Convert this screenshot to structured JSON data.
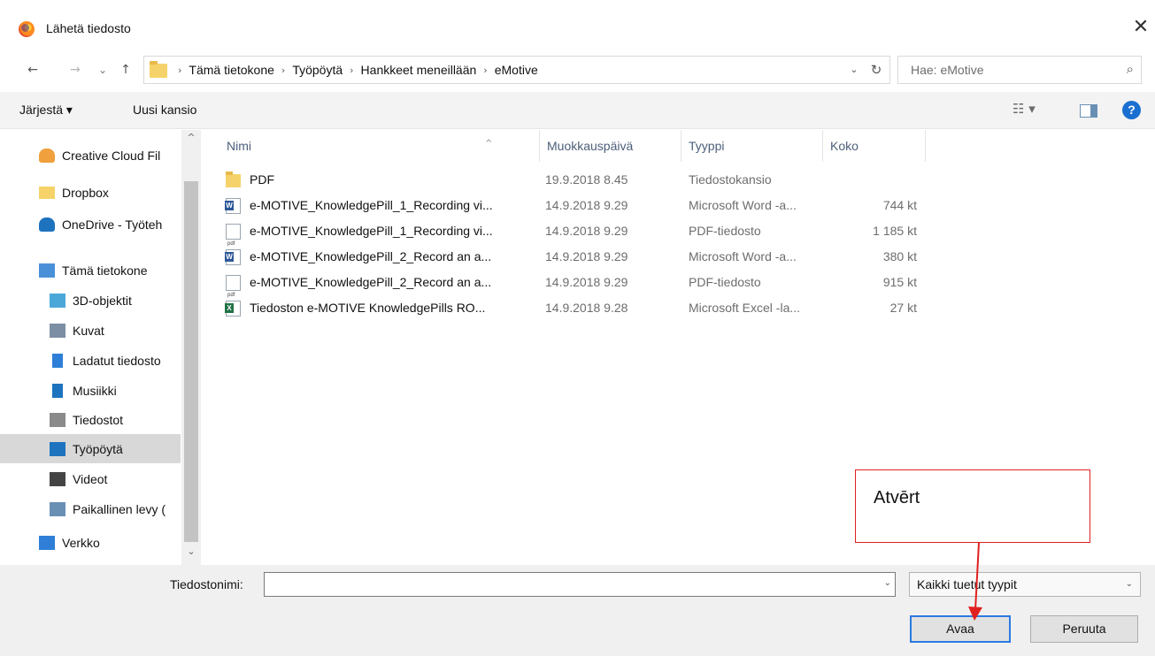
{
  "window": {
    "title": "Lähetä tiedosto",
    "close_glyph": "✕"
  },
  "nav": {
    "back_glyph": "←",
    "forward_glyph": "→",
    "recent_glyph": "⌄",
    "up_glyph": "↑"
  },
  "address": {
    "crumbs": [
      "Tämä tietokone",
      "Työpöytä",
      "Hankkeet meneillään",
      "eMotive"
    ],
    "sep_glyph": "›",
    "dropdown_glyph": "⌄",
    "refresh_glyph": "↻"
  },
  "search": {
    "placeholder": "Hae: eMotive",
    "icon_glyph": "⌕"
  },
  "toolbar": {
    "organize_label": "Järjestä ▾",
    "new_folder_label": "Uusi kansio",
    "view_glyph": "☷ ▾",
    "help_glyph": "?"
  },
  "sidebar": {
    "items": [
      {
        "label": "Creative Cloud Fil",
        "icon": "creative-cloud-icon",
        "color": "#f0a03c"
      },
      {
        "label": "Dropbox",
        "icon": "folder-icon",
        "color": "#f6d36a"
      },
      {
        "label": "OneDrive - Työteh",
        "icon": "onedrive-icon",
        "color": "#1e73be"
      },
      {
        "label": "Tämä tietokone",
        "icon": "computer-icon",
        "color": "#4a90d9"
      },
      {
        "label": "3D-objektit",
        "icon": "cube-icon",
        "color": "#4ca7d9"
      },
      {
        "label": "Kuvat",
        "icon": "pictures-icon",
        "color": "#7c8ea3"
      },
      {
        "label": "Ladatut tiedosto",
        "icon": "download-icon",
        "color": "#2f7fd8"
      },
      {
        "label": "Musiikki",
        "icon": "music-icon",
        "color": "#1e73be"
      },
      {
        "label": "Tiedostot",
        "icon": "documents-icon",
        "color": "#8a8a8a"
      },
      {
        "label": "Työpöytä",
        "icon": "desktop-icon",
        "color": "#1e73be",
        "selected": true
      },
      {
        "label": "Videot",
        "icon": "video-icon",
        "color": "#444444"
      },
      {
        "label": "Paikallinen levy (",
        "icon": "drive-icon",
        "color": "#6a8fb5"
      },
      {
        "label": "Verkko",
        "icon": "network-icon",
        "color": "#2f7fd8"
      }
    ],
    "scroll_up_glyph": "^",
    "scroll_down_glyph": "⌄"
  },
  "columns": {
    "name": "Nimi",
    "date": "Muokkauspäivä",
    "type": "Tyyppi",
    "size": "Koko",
    "sort_glyph": "^"
  },
  "files": [
    {
      "name": "PDF",
      "date": "19.9.2018 8.45",
      "type": "Tiedostokansio",
      "size": "",
      "icon": "folder"
    },
    {
      "name": "e-MOTIVE_KnowledgePill_1_Recording vi...",
      "date": "14.9.2018 9.29",
      "type": "Microsoft Word -a...",
      "size": "744 kt",
      "icon": "word"
    },
    {
      "name": "e-MOTIVE_KnowledgePill_1_Recording vi...",
      "date": "14.9.2018 9.29",
      "type": "PDF-tiedosto",
      "size": "1 185 kt",
      "icon": "pdf"
    },
    {
      "name": "e-MOTIVE_KnowledgePill_2_Record an a...",
      "date": "14.9.2018 9.29",
      "type": "Microsoft Word -a...",
      "size": "380 kt",
      "icon": "word"
    },
    {
      "name": "e-MOTIVE_KnowledgePill_2_Record an a...",
      "date": "14.9.2018 9.29",
      "type": "PDF-tiedosto",
      "size": "915 kt",
      "icon": "pdf"
    },
    {
      "name": "Tiedoston e-MOTIVE KnowledgePills RO...",
      "date": "14.9.2018 9.28",
      "type": "Microsoft Excel -la...",
      "size": "27 kt",
      "icon": "excel"
    }
  ],
  "footer": {
    "filename_label": "Tiedostonimi:",
    "filename_value": "",
    "filetype_value": "Kaikki tuetut tyypit",
    "dropdown_glyph": "⌄",
    "open_label": "Avaa",
    "cancel_label": "Peruuta"
  },
  "annotation": {
    "text": "Atvērt",
    "color": "#e02020"
  }
}
